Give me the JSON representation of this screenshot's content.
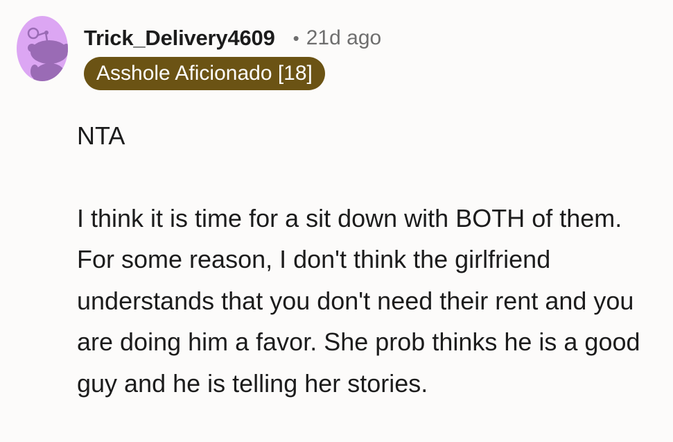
{
  "comment": {
    "username": "Trick_Delivery4609",
    "separator": "•",
    "timestamp": "21d ago",
    "flair": "Asshole Aficionado [18]",
    "avatar_icon": "reddit-snoo-icon",
    "paragraphs": [
      "NTA",
      "I think it is time for a sit down with BOTH of them. For some reason, I don't think the girlfriend understands that you don't need their rent and you are doing him a favor. She prob thinks he is a good guy and he is telling her stories."
    ]
  },
  "colors": {
    "background": "#fcfbfa",
    "avatar_bg": "#dca6f3",
    "avatar_figure": "#9a6bb5",
    "flair_bg": "#6b5314",
    "flair_text": "#ffffff",
    "meta_text": "#6e6e6e",
    "body_text": "#1c1c1c"
  }
}
